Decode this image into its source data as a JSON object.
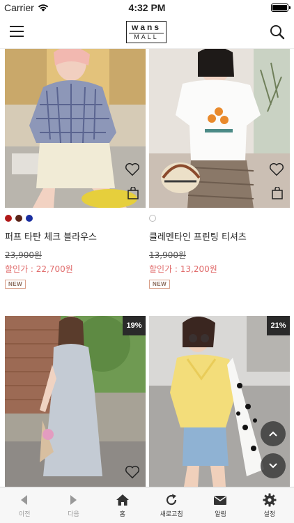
{
  "status_bar": {
    "carrier": "Carrier",
    "time": "4:32 PM"
  },
  "header": {
    "logo_top": "wans",
    "logo_bottom": "MALL"
  },
  "products": [
    {
      "name": "퍼프 타탄 체크 블라우스",
      "original_price": "23,900원",
      "sale_price": "할인가 : 22,700원",
      "badge": "NEW",
      "discount": "",
      "colors": [
        "#b01818",
        "#5a2418",
        "#1a2ea0"
      ]
    },
    {
      "name": "클레멘타인 프린팅 티셔츠",
      "original_price": "13,900원",
      "sale_price": "할인가 : 13,200원",
      "badge": "NEW",
      "discount": "",
      "colors": []
    },
    {
      "discount": "19%"
    },
    {
      "discount": "21%"
    }
  ],
  "toolbar": {
    "items": [
      {
        "label": "이전",
        "icon": "back-arrow-icon"
      },
      {
        "label": "다음",
        "icon": "forward-arrow-icon"
      },
      {
        "label": "홈",
        "icon": "home-icon"
      },
      {
        "label": "새로고침",
        "icon": "refresh-icon"
      },
      {
        "label": "알림",
        "icon": "mail-icon"
      },
      {
        "label": "설정",
        "icon": "gear-icon"
      }
    ]
  },
  "colors": {
    "sale": "#e06a6a",
    "badge_bg": "#2a2a2a",
    "toolbar_bg": "#f7f7f7"
  }
}
